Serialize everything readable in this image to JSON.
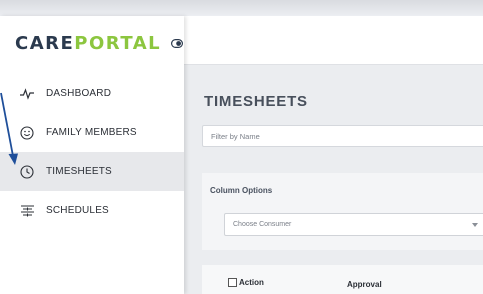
{
  "app": {
    "logo_care": "CARE",
    "logo_portal": "PORTAL"
  },
  "sidebar": {
    "items": [
      {
        "label": "DASHBOARD",
        "icon": "pulse-icon"
      },
      {
        "label": "FAMILY MEMBERS",
        "icon": "smiley-icon"
      },
      {
        "label": "TIMESHEETS",
        "icon": "clock-icon",
        "active": true
      },
      {
        "label": "SCHEDULES",
        "icon": "schedule-list-icon"
      }
    ]
  },
  "main": {
    "title": "TIMESHEETS",
    "filter_placeholder": "Filter by Name",
    "column_options_label": "Column Options",
    "consumer_select_value": "Choose Consumer",
    "table_headers": {
      "action": "Action",
      "approval": "Approval"
    }
  },
  "colors": {
    "brand_dark": "#2b3a4e",
    "brand_green": "#8cc63f",
    "active_nav_bg": "#e7e8eb",
    "main_bg": "#ebedf0",
    "annotation_arrow": "#1f4f9a"
  }
}
